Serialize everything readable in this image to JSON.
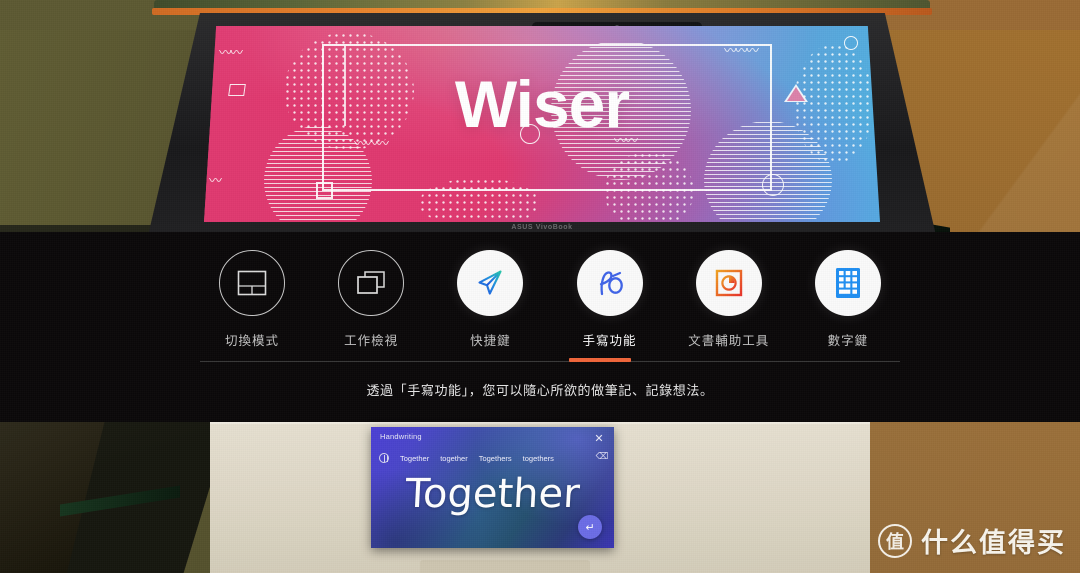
{
  "scene": {
    "background": {
      "left_wall_color": "#5d5a32",
      "right_wall_color": "#9a6a35",
      "desk_color": "#e0d9c7"
    }
  },
  "laptop": {
    "brand_label": "ASUS VivoBook",
    "wallpaper": {
      "title": "Wiser",
      "gradient_from": "#e23b73",
      "gradient_to": "#4fb3e2"
    }
  },
  "panel": {
    "background_color": "#0a0809",
    "accent_color": "#f0653a",
    "caption": "透過「手寫功能」，您可以隨心所欲的做筆記、記錄想法。",
    "features": [
      {
        "label": "切換模式",
        "icon": "touchpad-mode-icon",
        "style": "outline",
        "active": false
      },
      {
        "label": "工作檢視",
        "icon": "task-view-icon",
        "style": "outline",
        "active": false
      },
      {
        "label": "快捷鍵",
        "icon": "shortcut-paper-plane-icon",
        "style": "filled",
        "active": false
      },
      {
        "label": "手寫功能",
        "icon": "handwriting-pen-icon",
        "style": "filled",
        "active": true
      },
      {
        "label": "文書輔助工具",
        "icon": "document-tools-chart-icon",
        "style": "filled",
        "active": false
      },
      {
        "label": "數字鍵",
        "icon": "numpad-keypad-icon",
        "style": "filled",
        "active": false
      }
    ]
  },
  "handwriting_panel": {
    "title": "Handwriting",
    "close_label": "✕",
    "language_icon": "globe-icon",
    "backspace_label": "⌫",
    "suggestions": [
      "Together",
      "together",
      "Togethers",
      "togethers"
    ],
    "ink_text": "Together",
    "enter_label": "↵"
  },
  "watermark": {
    "badge": "值",
    "text": "什么值得买"
  }
}
